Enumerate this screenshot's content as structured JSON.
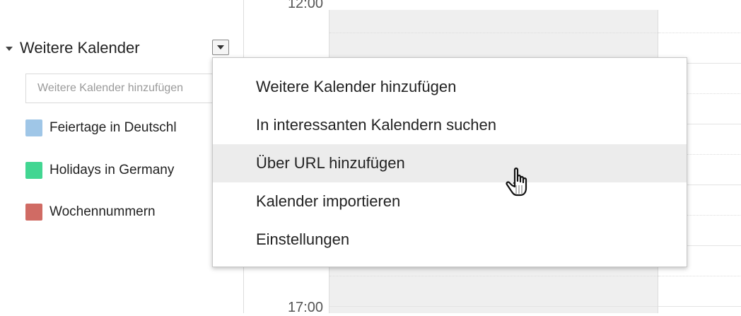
{
  "sidebar": {
    "section_title": "Weitere Kalender",
    "add_placeholder": "Weitere Kalender hinzufügen",
    "calendars": [
      {
        "label": "Feiertage in Deutschl",
        "color": "#9fc6e7"
      },
      {
        "label": "Holidays in Germany",
        "color": "#42d692"
      },
      {
        "label": "Wochennummern",
        "color": "#d06b64"
      }
    ]
  },
  "grid": {
    "time_top": "12:00",
    "time_bottom": "17:00"
  },
  "menu": {
    "items": [
      {
        "label": "Weitere Kalender hinzufügen"
      },
      {
        "label": "In interessanten Kalendern suchen"
      },
      {
        "label": "Über URL hinzufügen",
        "state": "hover"
      },
      {
        "label": "Kalender importieren"
      },
      {
        "label": "Einstellungen"
      }
    ]
  },
  "colors": {
    "day_column_bg": "#efefef",
    "menu_hover_bg": "#ececec"
  },
  "icons": {
    "cursor": "hand-pointer-icon",
    "collapse": "triangle-down-icon",
    "dropdown": "dropdown-arrow-icon"
  }
}
